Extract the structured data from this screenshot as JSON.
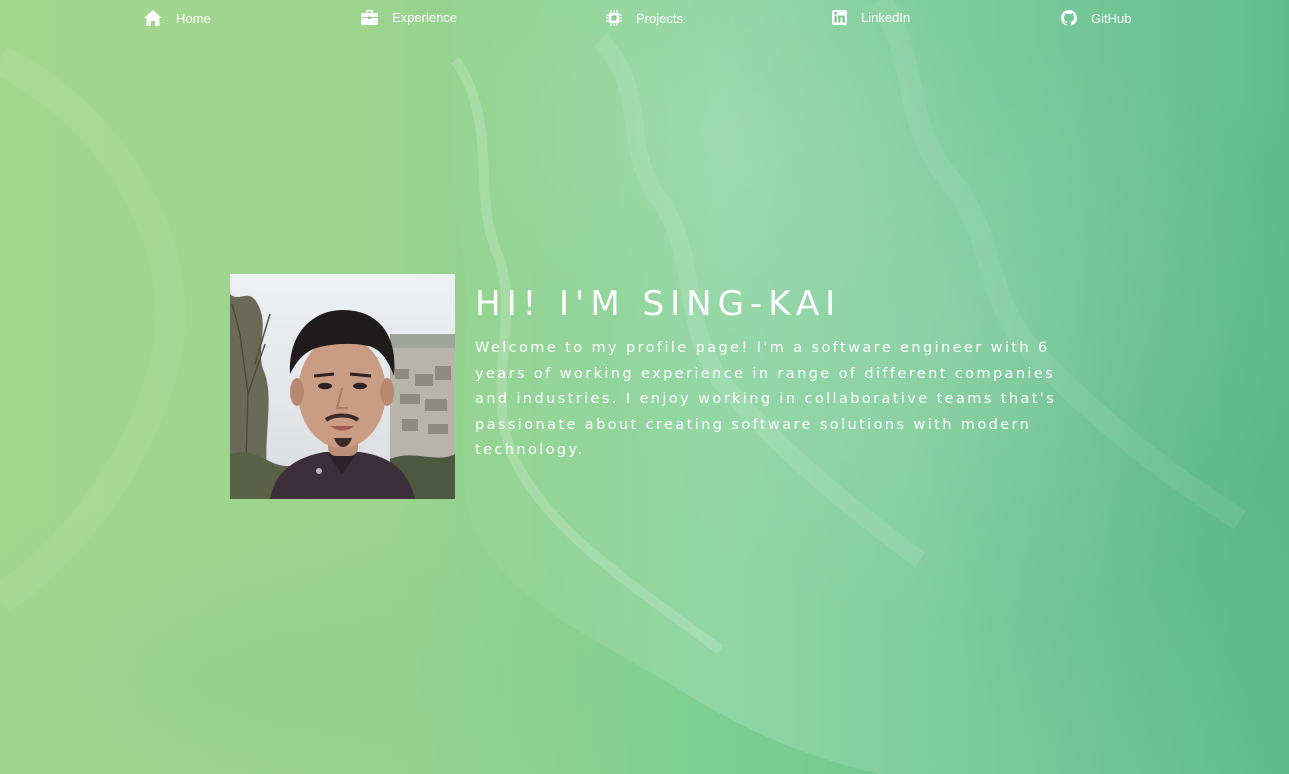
{
  "nav": {
    "items": [
      {
        "label": "Home",
        "icon": "home-icon"
      },
      {
        "label": "Experience",
        "icon": "briefcase-icon"
      },
      {
        "label": "Projects",
        "icon": "chip-icon"
      },
      {
        "label": "LinkedIn",
        "icon": "linkedin-icon"
      },
      {
        "label": "GitHub",
        "icon": "github-icon"
      }
    ]
  },
  "hero": {
    "title": "HI! I'M SING-KAI",
    "intro": "Welcome to my profile page! I'm a software engineer with 6 years of working experience in range of different companies and industries. I enjoy working in collaborative teams that's passionate about creating software solutions with modern technology.",
    "photo_alt": "profile-photo"
  },
  "colors": {
    "background_left": "#a4d78e",
    "background_right": "#58b987",
    "text": "#ffffff"
  }
}
